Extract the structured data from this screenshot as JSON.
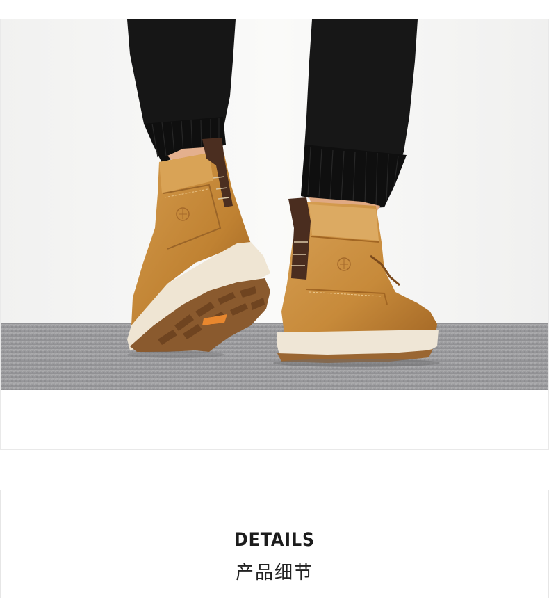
{
  "details": {
    "title": "DETAILS",
    "subtitle": "产品细节"
  },
  "photo": {
    "subject": "boots-photo",
    "colors": {
      "wall": "#f6f6f5",
      "carpet": "#9b9b9d",
      "pants": "#151515",
      "leather": "#c98c3c",
      "leather_shadow": "#a86a26",
      "sole": "#efe6d6",
      "outsole": "#8a5a2c",
      "pull_tab": "#4a2e22"
    }
  }
}
